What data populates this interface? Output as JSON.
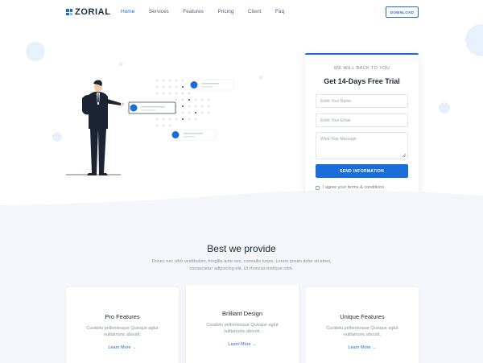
{
  "brand": {
    "name": "ZORIAL"
  },
  "nav": {
    "items": [
      {
        "label": "Home",
        "active": true
      },
      {
        "label": "Services",
        "active": false
      },
      {
        "label": "Features",
        "active": false
      },
      {
        "label": "Pricing",
        "active": false
      },
      {
        "label": "Client",
        "active": false
      },
      {
        "label": "Faq",
        "active": false
      }
    ],
    "download_label": "DOWNLOAD"
  },
  "form": {
    "kicker": "WE WILL BACK TO YOU",
    "title": "Get 14-Days Free Trial",
    "name_placeholder": "Enter Your Name",
    "email_placeholder": "Enter Your Email",
    "message_placeholder": "Write Your Message",
    "submit_label": "SEND INFORMATION",
    "agree_label": "I agree your terms & conditions"
  },
  "provide": {
    "title": "Best we provide",
    "description_line1": "Donec nec nibh vestibulum, fringilla ante nec, convallis turpis. Lorem ipsum dolor sit amet,",
    "description_line2": "consectetur adipiscing elit. Ut rhoncus tristique nibh.",
    "cards": [
      {
        "title": "Pro Features",
        "desc1": "Curabitu pellentesque Quisque agtut",
        "desc2": "nulltatnunc aboutit.",
        "link": "Learn More"
      },
      {
        "title": "Brilliant Design",
        "desc1": "Curabitu pellentesque Quisque agtut",
        "desc2": "nulltatnunc aboutit.",
        "link": "Learn More"
      },
      {
        "title": "Unique Features",
        "desc1": "Curabitu pellentesque Quisque agtut",
        "desc2": "nulltatnunc aboutit.",
        "link": "Learn More"
      }
    ]
  },
  "colors": {
    "accent": "#1a6dd9",
    "section_bg": "#f4f6fa"
  },
  "icons": [
    "logo-grid-icon",
    "arrow-right-icon",
    "checkbox-icon",
    "resize-handle-icon"
  ]
}
